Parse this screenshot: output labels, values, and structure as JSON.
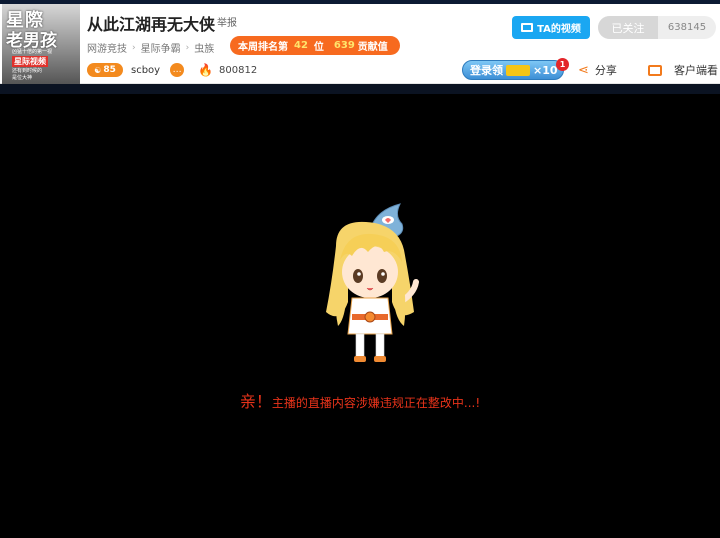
{
  "header": {
    "thumb": {
      "line1": "星際",
      "line2": "老男孩",
      "line3": "凶猛十倍的第一视",
      "tag": "星际视频",
      "line5": "还有到时候的",
      "line6": "是位大神"
    },
    "title": "从此江湖再无大侠",
    "report": "举报",
    "breadcrumbs": [
      "网游竞技",
      "星际争霸",
      "虫族"
    ],
    "rank": {
      "prefix": "本周排名第",
      "rank": "42",
      "unit": "位",
      "score": "639",
      "score_label": "贡献值"
    },
    "level": "85",
    "anchor": "scboy",
    "popularity": "800812",
    "ta_video_label": "TA的视频",
    "follow_label": "已关注",
    "follower_count": "638145",
    "login_label": "登录领",
    "login_multiplier": "×10",
    "badge": "1",
    "share_label": "分享",
    "client_label": "客户端看"
  },
  "player": {
    "notice_prefix": "亲！",
    "notice": "主播的直播内容涉嫌违规正在整改中...!"
  },
  "colors": {
    "accent_orange": "#f76a1f",
    "ta_blue": "#1aa7f2",
    "notice_red": "#e8331a"
  }
}
